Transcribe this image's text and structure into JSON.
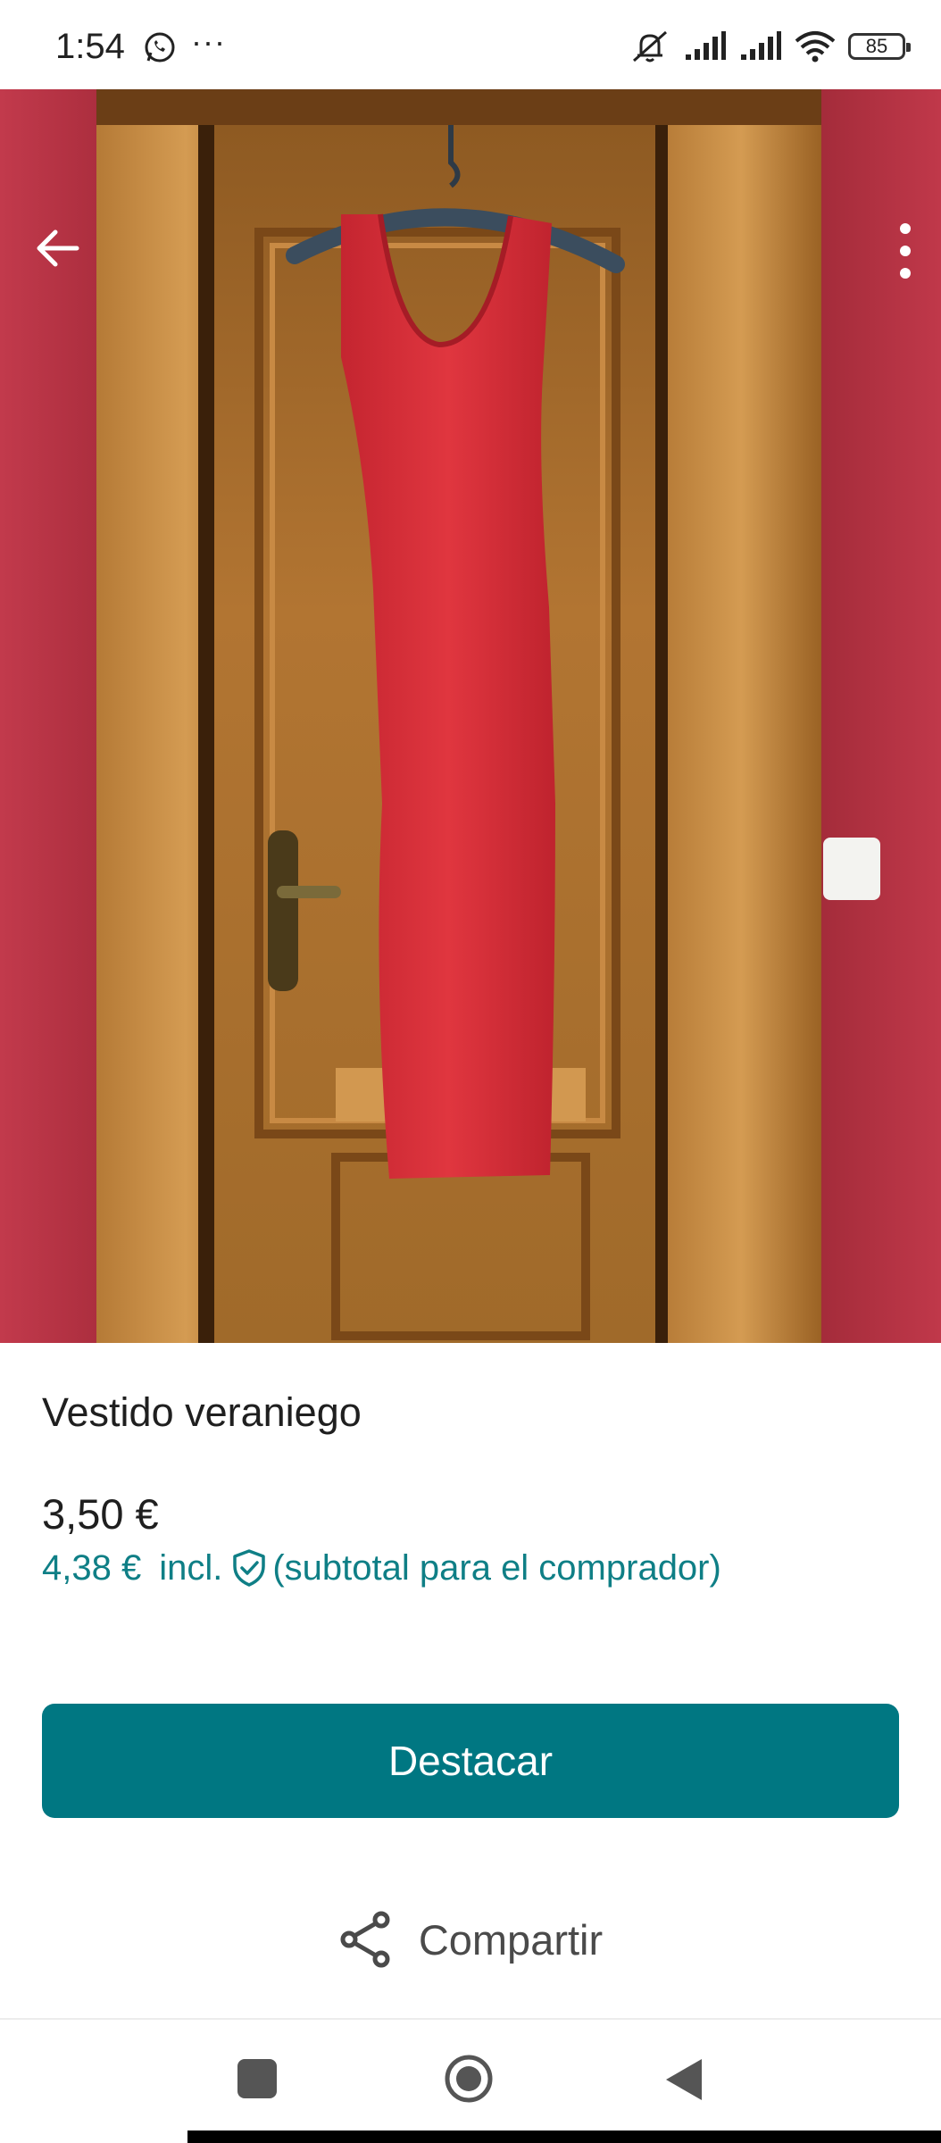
{
  "status_bar": {
    "time": "1:54",
    "more": "···",
    "battery": "85",
    "icons": [
      "whatsapp-icon",
      "muted-bell-icon",
      "signal-icon",
      "signal-icon",
      "wifi-icon",
      "battery-icon"
    ]
  },
  "photo": {
    "image_count": 3,
    "active_index": 1,
    "icons": {
      "back": "arrow-left-icon",
      "menu": "more-vertical-icon"
    }
  },
  "item": {
    "title": "Vestido veraniego",
    "price": "3,50 €",
    "buyer_total": "4,38 €",
    "buyer_incl": "incl.",
    "buyer_note": "(subtotal para el comprador)"
  },
  "actions": {
    "primary": "Destacar",
    "share": "Compartir"
  },
  "colors": {
    "accent": "#007782",
    "accent_text": "#0f7f86",
    "wall": "#b73646",
    "door": "#a06a2a",
    "dress": "#d7303b"
  }
}
